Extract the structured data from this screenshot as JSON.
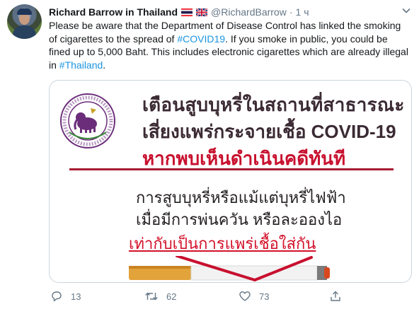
{
  "tweet": {
    "display_name": "Richard Barrow in Thailand",
    "handle": "@RichardBarrow",
    "separator": "·",
    "time": "1 ч",
    "text": {
      "p1": "Please be aware that the Department of Disease Control has linked the smoking of cigarettes to the spread of ",
      "hashtag1": "#COVID19",
      "p2": ".  If you smoke in public, you could be fined up to 5,000 Baht. This includes electronic cigarettes which are already illegal in ",
      "hashtag2": "#Thailand",
      "p3": "."
    },
    "icons": [
      "thailand-flag-icon",
      "uk-flag-icon",
      "chevron-down-icon"
    ],
    "colors": {
      "link": "#1b95e0",
      "muted": "#657786",
      "text": "#14171a"
    }
  },
  "card": {
    "heading_line1": "เตือนสูบบุหรี่ในสถานที่สาธารณะ",
    "heading_line2": "เสี่ยงแพร่กระจายเชื้อ COVID-19",
    "heading_line3": "หากพบเห็นดำเนินคดีทันที",
    "body_line1": "การสูบบุหรี่หรือแม้แต่บุหรี่ไฟฟ้า",
    "body_line2": "เมื่อมีการพ่นควัน หรือละอองไอ",
    "body_line3": "เท่ากับเป็นการแพร่เชื้อใส่กัน",
    "colors": {
      "heading": "#3b2a33",
      "alert": "#c8102e",
      "rule": "#a81c32"
    }
  },
  "actions": {
    "reply_count": "13",
    "retweet_count": "62",
    "like_count": "73",
    "icons": [
      "reply-icon",
      "retweet-icon",
      "like-icon",
      "share-icon"
    ]
  }
}
